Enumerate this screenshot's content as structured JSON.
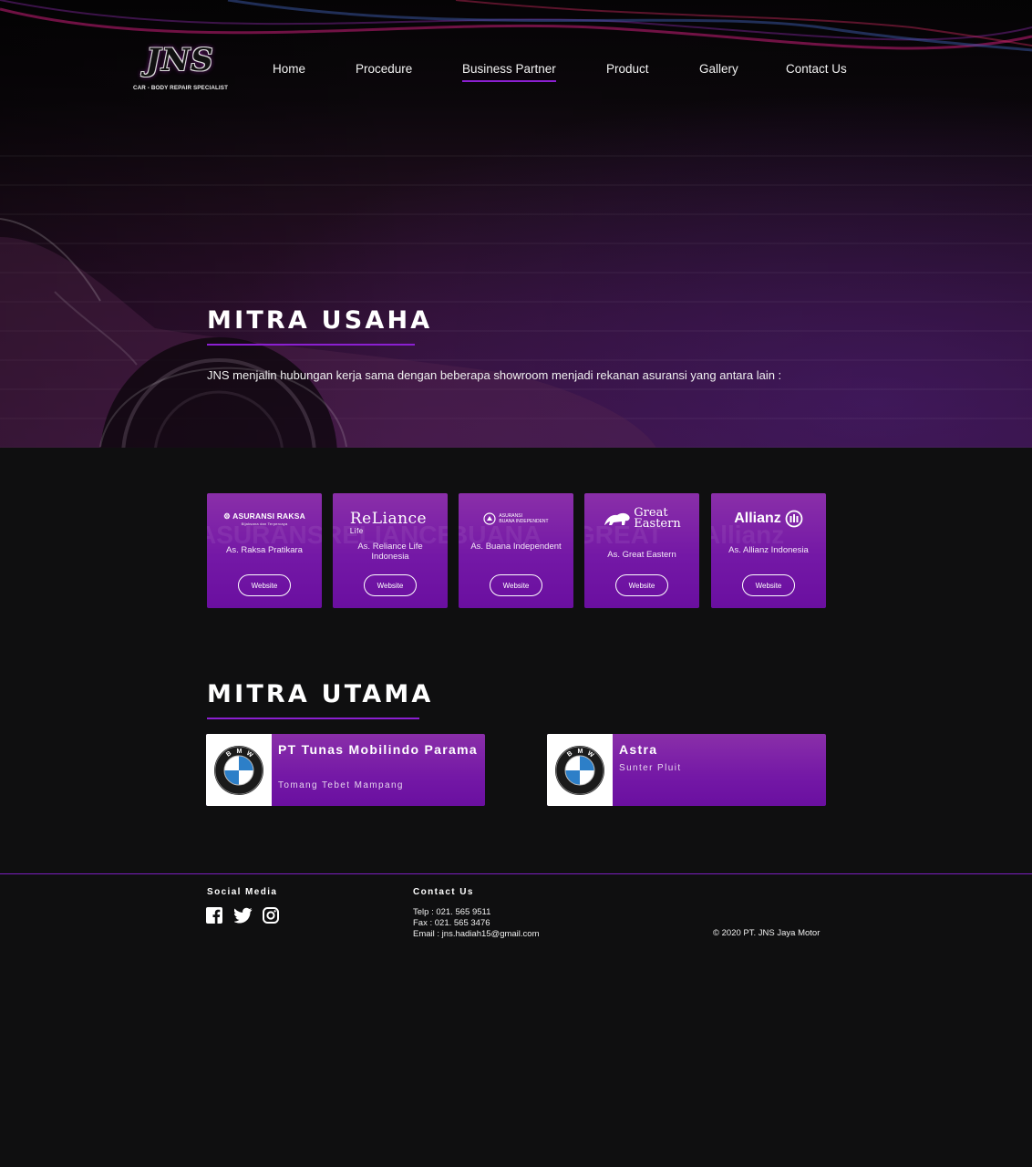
{
  "brand": {
    "logo_text": "JNS",
    "tagline": "CAR - BODY REPAIR SPECIALIST"
  },
  "nav": {
    "items": [
      {
        "label": "Home"
      },
      {
        "label": "Procedure"
      },
      {
        "label": "Business Partner",
        "active": true
      },
      {
        "label": "Product"
      },
      {
        "label": "Gallery"
      },
      {
        "label": "Contact Us"
      }
    ]
  },
  "hero": {
    "title": "MITRA USAHA",
    "description": "JNS menjalin hubungan kerja sama dengan beberapa showroom menjadi rekanan asuransi yang antara lain :"
  },
  "partners": [
    {
      "logo_text": "ASURANSI RAKSA",
      "logo_sub": "Bijaksana dan Terpercaya",
      "logo_icon": "raksa-emblem-icon",
      "name": "As. Raksa Pratikara",
      "button": "Website"
    },
    {
      "logo_text": "ReLiance",
      "logo_sub": "Life",
      "name": "As. Reliance Life Indonesia",
      "button": "Website"
    },
    {
      "logo_text": "ASURANSI",
      "logo_sub": "BUANA INDEPENDENT",
      "logo_icon": "buana-emblem-icon",
      "name": "As. Buana Independent",
      "button": "Website"
    },
    {
      "logo_text": "Great",
      "logo_sub": "Eastern",
      "logo_icon": "lion-icon",
      "name": "As. Great Eastern",
      "button": "Website"
    },
    {
      "logo_text": "Allianz",
      "logo_icon": "allianz-eagle-icon",
      "name": "As. Allianz Indonesia",
      "button": "Website"
    }
  ],
  "main_partners": {
    "title": "MITRA UTAMA",
    "items": [
      {
        "name": "PT Tunas Mobilindo Parama",
        "location": "Tomang Tebet Mampang",
        "logo_icon": "bmw-logo-icon",
        "logo_letters": "BMW"
      },
      {
        "name": "Astra",
        "location": "Sunter Pluit",
        "logo_icon": "bmw-logo-icon",
        "logo_letters": "BMW"
      }
    ]
  },
  "footer": {
    "social_title": "Social Media",
    "social_icons": [
      "facebook-icon",
      "twitter-icon",
      "instagram-icon"
    ],
    "contact_title": "Contact Us",
    "telp": "Telp : 021. 565 9511",
    "fax": "Fax : 021. 565 3476",
    "email": "Email : jns.hadiah15@gmail.com",
    "copyright": "© 2020 PT. JNS Jaya Motor"
  },
  "colors": {
    "accent": "#8b1fd1",
    "card": "#7418a6",
    "background": "#0f0f10"
  }
}
